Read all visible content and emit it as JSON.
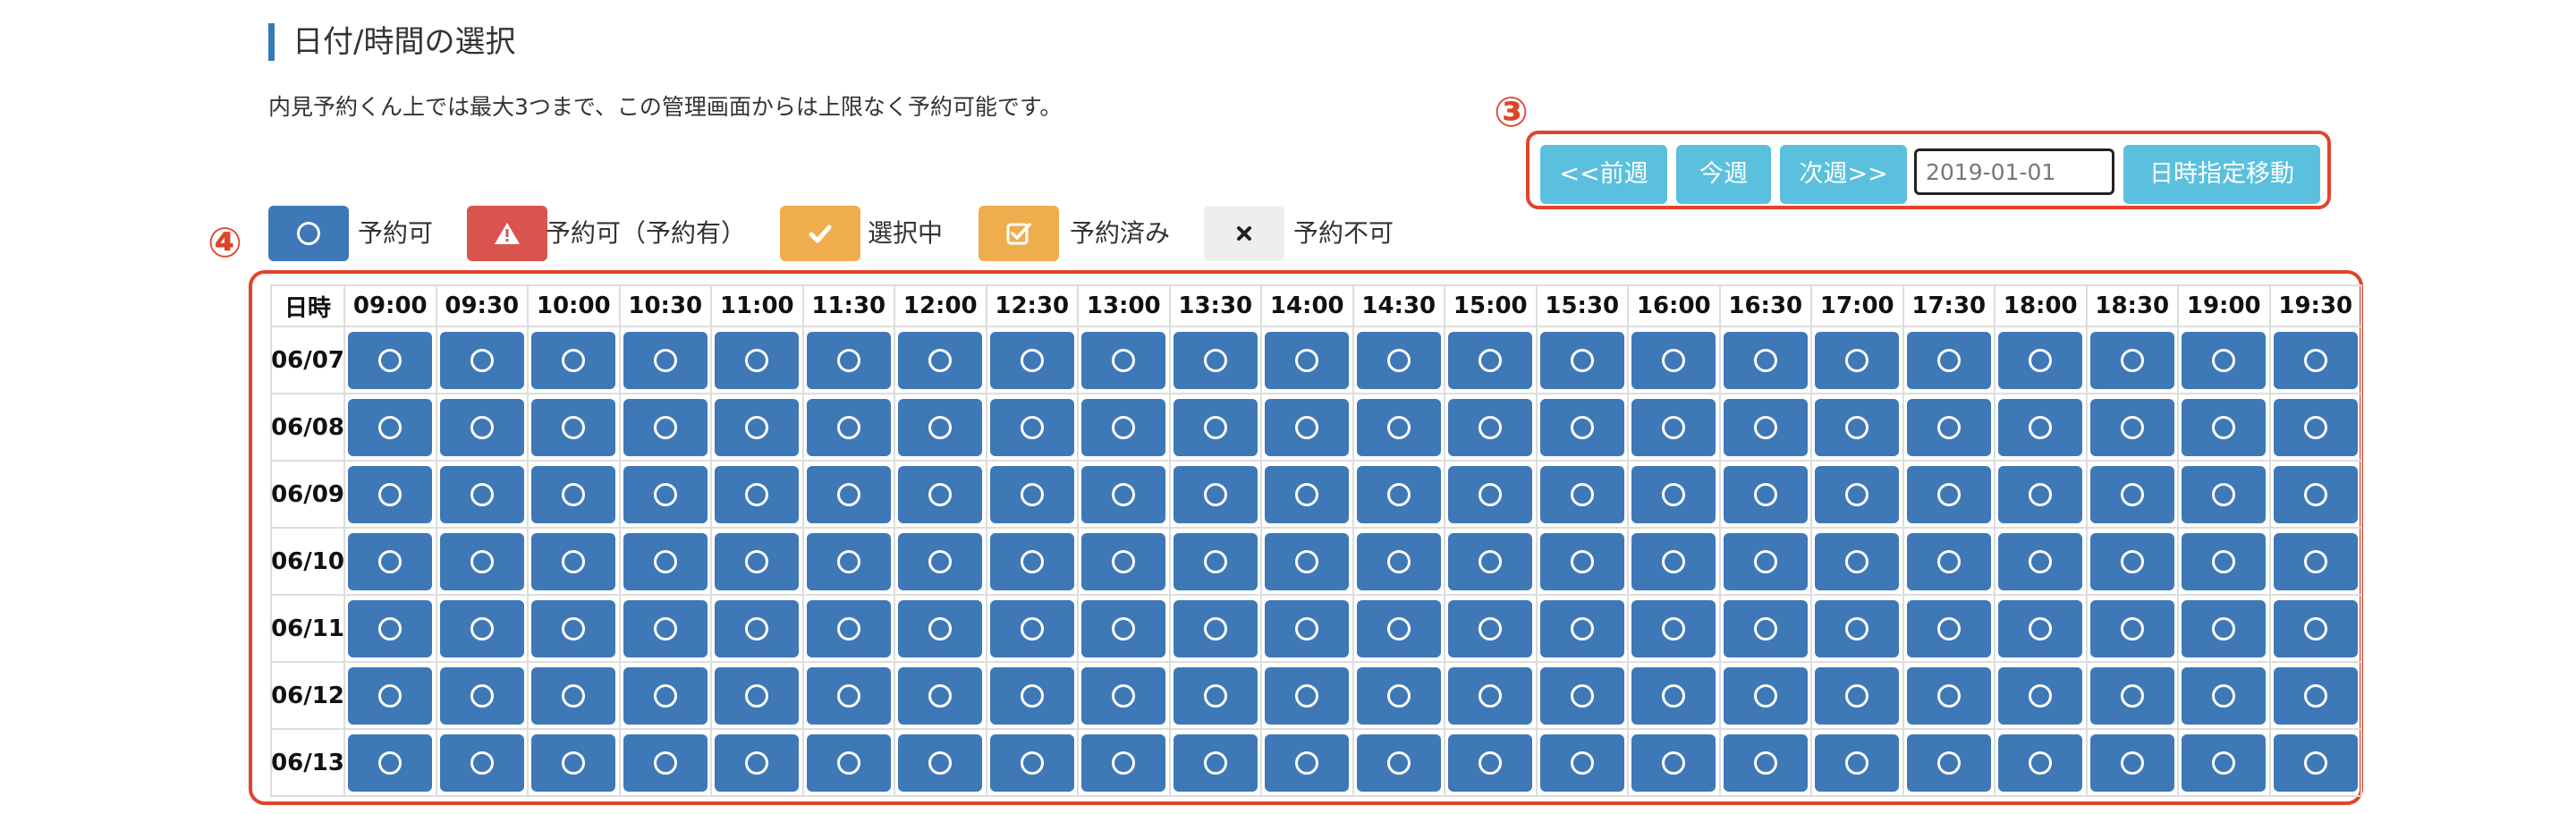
{
  "section": {
    "title": "日付/時間の選択",
    "description": "内見予約くん上では最大3つまで、この管理画面からは上限なく予約可能です。"
  },
  "annotations": {
    "nav": "③",
    "table": "④"
  },
  "nav": {
    "prev_label": "<<前週",
    "this_week_label": "今週",
    "next_label": "次週>>",
    "date_value": "2019-01-01",
    "jump_label": "日時指定移動"
  },
  "legend": [
    {
      "key": "available",
      "label": "予約可",
      "color": "#3f78b7",
      "icon": "circle-icon"
    },
    {
      "key": "available-booked",
      "label": "予約可（予約有）",
      "color": "#d9534f",
      "icon": "warning-icon"
    },
    {
      "key": "selected",
      "label": "選択中",
      "color": "#f0ad4e",
      "icon": "check-icon"
    },
    {
      "key": "reserved",
      "label": "予約済み",
      "color": "#f0ad4e",
      "icon": "checkbox-icon"
    },
    {
      "key": "unavailable",
      "label": "予約不可",
      "color": "#eeeeee",
      "icon": "x-icon"
    }
  ],
  "table": {
    "corner_label": "日時",
    "times": [
      "09:00",
      "09:30",
      "10:00",
      "10:30",
      "11:00",
      "11:30",
      "12:00",
      "12:30",
      "13:00",
      "13:30",
      "14:00",
      "14:30",
      "15:00",
      "15:30",
      "16:00",
      "16:30",
      "17:00",
      "17:30",
      "18:00",
      "18:30",
      "19:00",
      "19:30"
    ],
    "dates": [
      "06/07",
      "06/08",
      "06/09",
      "06/10",
      "06/11",
      "06/12",
      "06/13"
    ],
    "slot_status": "available"
  }
}
